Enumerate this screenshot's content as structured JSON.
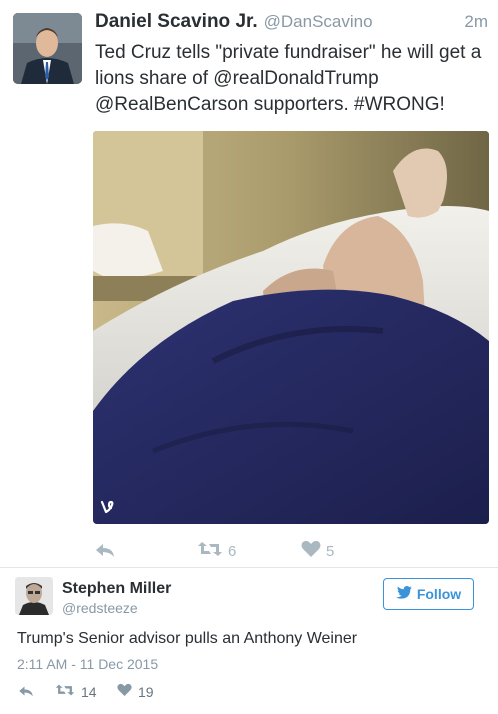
{
  "tweet": {
    "author_name": "Daniel Scavino Jr.",
    "author_handle": "@DanScavino",
    "time": "2m",
    "text": "Ted Cruz tells \"private fundraiser\" he will get a lions share of @realDonaldTrump @RealBenCarson supporters. #WRONG!",
    "retweet_count": "6",
    "like_count": "5"
  },
  "quote": {
    "author_name": "Stephen Miller",
    "author_handle": "@redsteeze",
    "follow_label": "Follow",
    "text": "Trump's Senior advisor pulls an Anthony Weiner",
    "timestamp": "2:11 AM - 11 Dec 2015",
    "retweet_count": "14",
    "like_count": "19"
  },
  "colors": {
    "accent": "#3b94d9",
    "muted": "#8899a6",
    "text": "#292f33",
    "action_icon": "#aab8c2"
  },
  "icons": [
    "reply-icon",
    "retweet-icon",
    "heart-icon",
    "vine-icon",
    "twitter-bird-icon"
  ]
}
